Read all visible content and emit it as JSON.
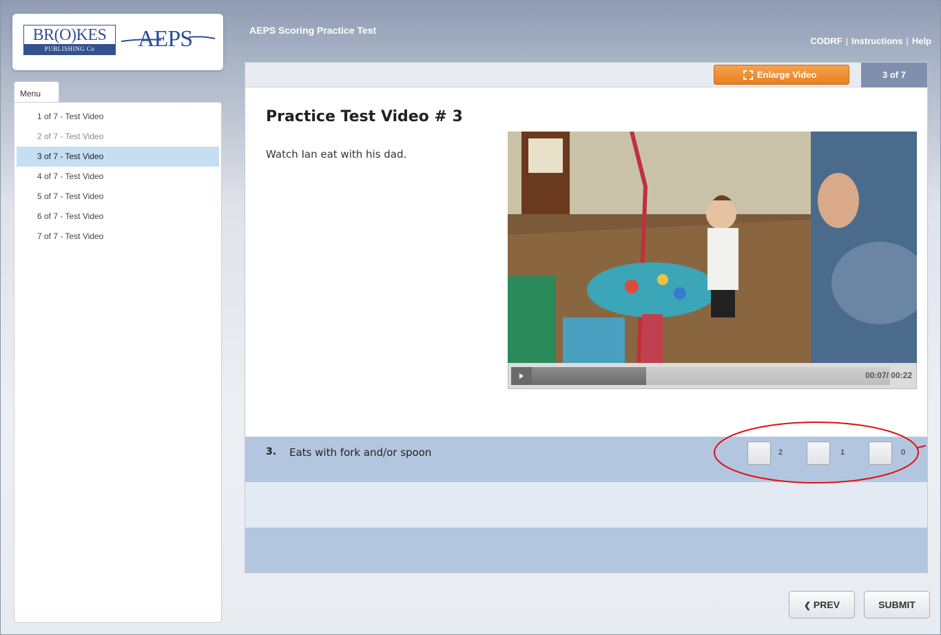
{
  "logo": {
    "brookes_top": "BR(O)KES",
    "brookes_bottom": "PUBLISHING Co",
    "aeps": "AEPS"
  },
  "header": {
    "title": "AEPS Scoring Practice Test",
    "links": [
      "CODRF",
      "Instructions",
      "Help"
    ]
  },
  "sidebar": {
    "tab_label": "Menu",
    "items": [
      {
        "label": "1 of 7 - Test Video"
      },
      {
        "label": "2 of 7 - Test Video"
      },
      {
        "label": "3 of 7 - Test Video"
      },
      {
        "label": "4 of 7 - Test Video"
      },
      {
        "label": "5 of 7 - Test Video"
      },
      {
        "label": "6 of 7 - Test Video"
      },
      {
        "label": "7 of 7 - Test Video"
      }
    ],
    "active_index": 2
  },
  "main": {
    "enlarge_label": "Enlarge Video",
    "counter": "3 of 7",
    "title": "Practice Test Video # 3",
    "instructions": "Watch Ian eat with his dad.",
    "video": {
      "time": "00:07/ 00:22",
      "progress": 0.32
    },
    "question": {
      "number": "3.",
      "text": "Eats with fork and/or spoon",
      "options": [
        "2",
        "1",
        "0"
      ]
    }
  },
  "nav": {
    "prev_label": "PREV",
    "submit_label": "SUBMIT"
  },
  "colors": {
    "accent_orange": "#e8801f",
    "counter_bg": "#7f8fad",
    "row_blue": "#b3c6df",
    "active_item": "#c5def2",
    "annotation_red": "#e01010"
  }
}
